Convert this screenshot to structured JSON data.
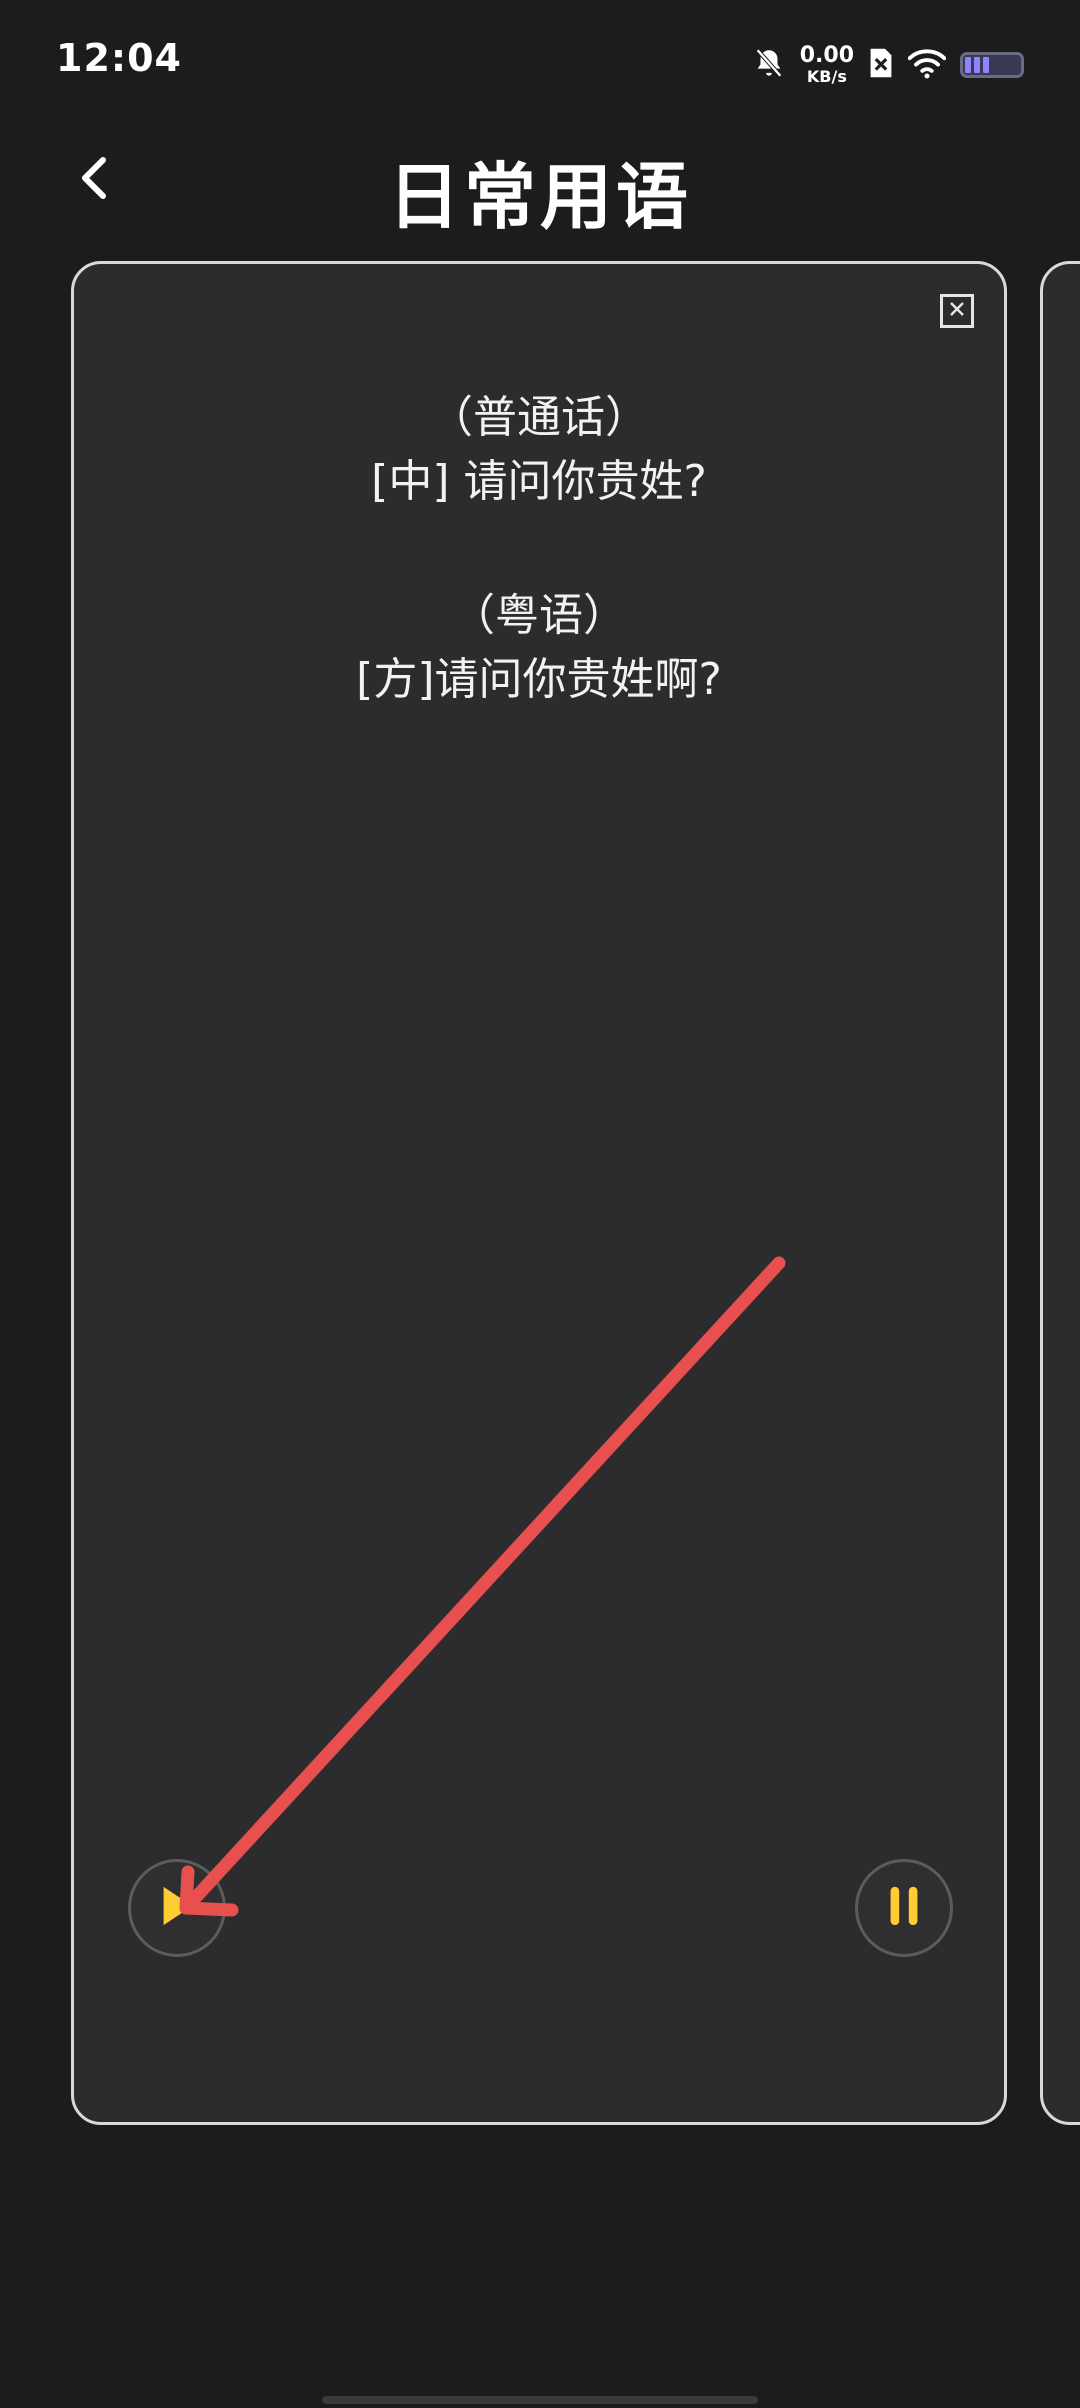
{
  "status_bar": {
    "time": "12:04",
    "net_speed_value": "0.00",
    "net_speed_unit": "KB/s",
    "icons": [
      "bell-muted-icon",
      "sim-card-x-icon",
      "wifi-icon",
      "battery-icon"
    ]
  },
  "header": {
    "back_icon": "chevron-left-icon",
    "title": "日常用语"
  },
  "card": {
    "close_icon": "close-icon",
    "phrases": [
      {
        "language": "（普通话）",
        "text": "[中] 请问你贵姓?"
      },
      {
        "language": "（粤语）",
        "text": "[方]请问你贵姓啊?"
      }
    ],
    "controls": {
      "play_icon": "play-icon",
      "pause_icon": "pause-icon"
    }
  },
  "colors": {
    "background": "#1c1c1e",
    "card_background": "#2c2c2e",
    "card_border": "#d9d9d9",
    "control_accent": "#ffcc33",
    "annotation_arrow": "#e84f4f"
  }
}
